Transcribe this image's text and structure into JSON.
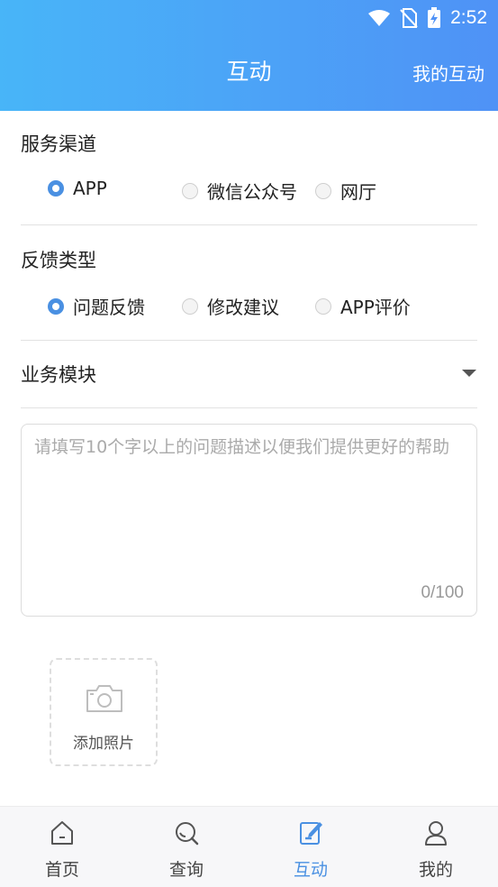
{
  "status_bar": {
    "time": "2:52"
  },
  "header": {
    "title": "互动",
    "right_link": "我的互动"
  },
  "service_channel": {
    "label": "服务渠道",
    "options": [
      "APP",
      "微信公众号",
      "网厅"
    ],
    "selected": "APP"
  },
  "feedback_type": {
    "label": "反馈类型",
    "options": [
      "问题反馈",
      "修改建议",
      "APP评价"
    ],
    "selected": "问题反馈"
  },
  "business_module": {
    "label": "业务模块"
  },
  "description": {
    "placeholder": "请填写10个字以上的问题描述以便我们提供更好的帮助",
    "value": "",
    "counter": "0/100"
  },
  "photo": {
    "label": "添加照片"
  },
  "tabbar": {
    "items": [
      {
        "label": "首页",
        "icon": "home-icon"
      },
      {
        "label": "查询",
        "icon": "search-icon"
      },
      {
        "label": "互动",
        "icon": "edit-note-icon"
      },
      {
        "label": "我的",
        "icon": "user-icon"
      }
    ],
    "active": "互动",
    "accent": "#4a90e2"
  },
  "colors": {
    "header_start": "#48b5f8",
    "header_end": "#4f92f6",
    "accent": "#4a90e2"
  }
}
